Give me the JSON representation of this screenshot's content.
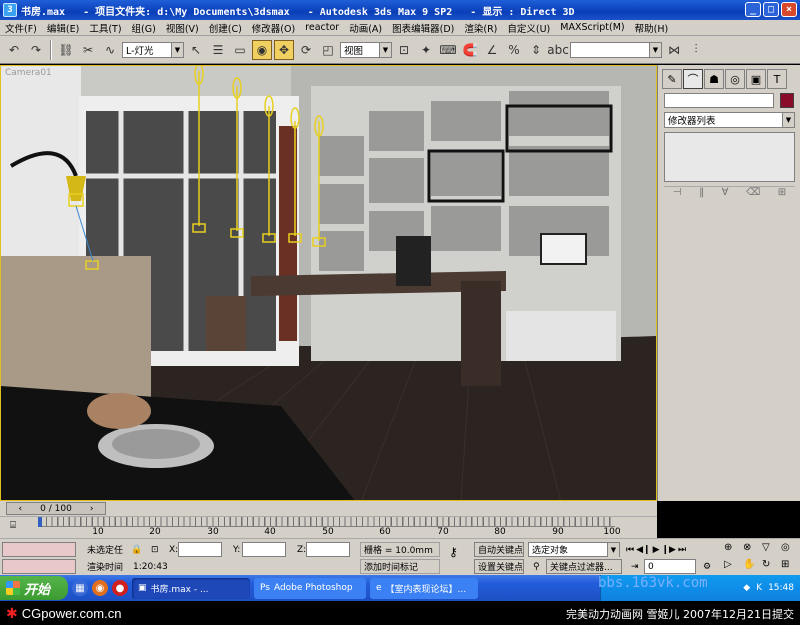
{
  "title_bar": {
    "title": "书房.max   - 项目文件夹: d:\\My Documents\\3dsmax   - Autodesk 3ds Max 9 SP2   - 显示 : Direct 3D",
    "min_icon": "_",
    "max_icon": "□",
    "close_icon": "×"
  },
  "menu": [
    "文件(F)",
    "编辑(E)",
    "工具(T)",
    "组(G)",
    "视图(V)",
    "创建(C)",
    "修改器(O)",
    "reactor",
    "动画(A)",
    "图表编辑器(D)",
    "渲染(R)",
    "自定义(U)",
    "MAXScript(M)",
    "帮助(H)"
  ],
  "toolbar": {
    "selection_filter": "L-灯光",
    "ref_coord": "视图",
    "named_selection": ""
  },
  "viewport": {
    "label": "Camera01"
  },
  "command_panel": {
    "modifier_list": "修改器列表",
    "tabs": [
      "create-icon",
      "modify-icon",
      "hierarchy-icon",
      "motion-icon",
      "display-icon",
      "utilities-icon"
    ]
  },
  "timeline": {
    "frame_counter": "0 / 100",
    "ticks": [
      "10",
      "20",
      "30",
      "40",
      "50",
      "60",
      "70",
      "80",
      "90",
      "100"
    ]
  },
  "status": {
    "selection": "未选定任",
    "x_label": "X:",
    "y_label": "Y:",
    "z_label": "Z:",
    "grid": "栅格 = 10.0mm",
    "auto_key": "自动关键点",
    "set_key": "设置关键点",
    "selected_object": "选定对象",
    "key_filters": "关键点过滤器...",
    "render_time_label": "渲染时间",
    "render_time": "1:20:43",
    "add_time_tag": "添加时间标记",
    "current_frame": "0"
  },
  "taskbar": {
    "start": "开始",
    "tasks": [
      "书房.max - ...",
      "Adobe Photoshop",
      "【室内表现论坛】..."
    ],
    "watermark": "bbs.163vk.com",
    "clock": "15:48"
  },
  "footer": {
    "logo": "CGpower.com.cn",
    "credit": "完美动力动画网 雪姬儿 2007年12月21日提交"
  }
}
